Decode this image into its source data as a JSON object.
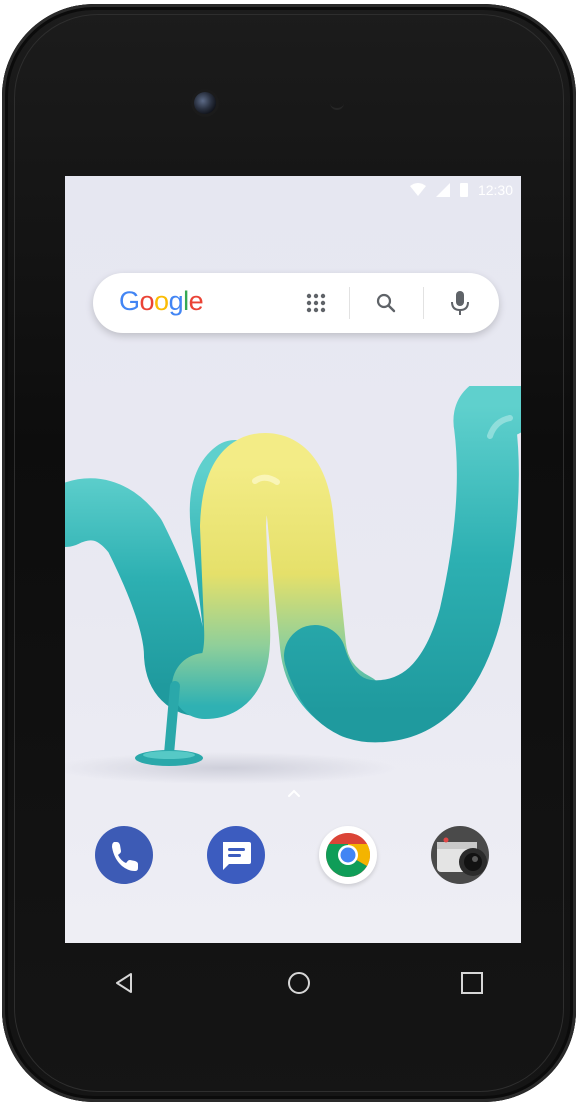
{
  "status_bar": {
    "time": "12:30",
    "icons": [
      "wifi-icon",
      "signal-icon",
      "battery-icon"
    ]
  },
  "search_bar": {
    "logo_letters": [
      "G",
      "o",
      "o",
      "g",
      "l",
      "e"
    ],
    "icons": [
      "apps-grid-icon",
      "search-icon",
      "microphone-icon"
    ]
  },
  "wallpaper": {
    "subject": "wiko-w-logo",
    "colors": {
      "teal": "#2fb1b3",
      "yellow": "#e9e36a",
      "background": "#e8e8f1"
    }
  },
  "dock": {
    "apps": [
      "phone-app-icon",
      "messages-app-icon",
      "chrome-app-icon",
      "camera-app-icon"
    ]
  },
  "nav_bar": {
    "buttons": [
      "back-icon",
      "home-icon",
      "recents-icon"
    ]
  },
  "colors": {
    "phone_body": "#111111",
    "dock_blue": "#3d5bb5",
    "google_blue": "#4285f4",
    "google_red": "#ea4335",
    "google_yellow": "#fbbc05",
    "google_green": "#34a853"
  }
}
